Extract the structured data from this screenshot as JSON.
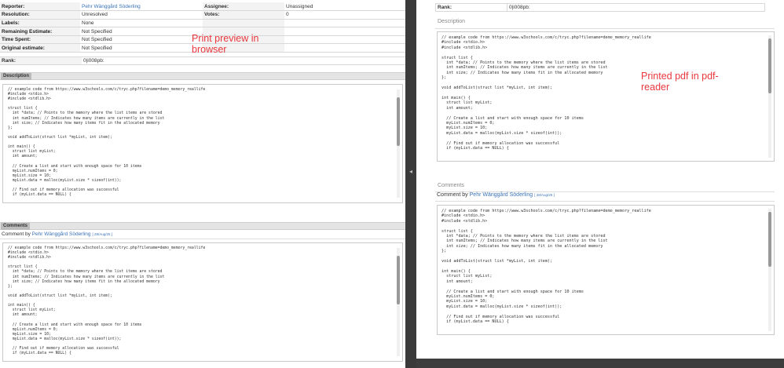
{
  "left": {
    "fields": [
      {
        "label": "Reporter:",
        "value": "Pehr Wänggård Söderling",
        "is_link": true,
        "label2": "Assignee:",
        "value2": "Unassigned"
      },
      {
        "label": "Resolution:",
        "value": "Unresolved",
        "label2": "Votes:",
        "value2": "0"
      },
      {
        "label": "Labels:",
        "value": "None",
        "label2": "",
        "value2": ""
      },
      {
        "label": "Remaining Estimate:",
        "value": "Not Specified",
        "label2": "",
        "value2": ""
      },
      {
        "label": "Time Spent:",
        "value": "Not Specified",
        "label2": "",
        "value2": ""
      },
      {
        "label": "Original estimate:",
        "value": "Not Specified",
        "label2": "",
        "value2": ""
      }
    ],
    "rank_label": "Rank:",
    "rank_value": "0|i008pb:",
    "description_tab": "Description",
    "comments_tab": "Comments",
    "comment_prefix": "Comment by",
    "comment_author": "Pehr Wänggård Söderling",
    "comment_date": "[ 28/Aug/25 ]",
    "annotation": "Print preview in\nbrowser"
  },
  "right": {
    "rank_label": "Rank:",
    "rank_value": "0|i008pb:",
    "description_title": "Description",
    "comments_title": "Comments",
    "comment_prefix": "Comment by",
    "comment_author": "Pehr Wänggård Söderling",
    "comment_date": "[ 28/Aug/25 ]",
    "annotation": "Printed pdf in pdf-\nreader"
  },
  "code": "// example code from https://www.w3schools.com/c/tryc.php?filename=demo_memory_reallife\n#include <stdio.h>\n#include <stdlib.h>\n\nstruct list {\n  int *data; // Points to the memory where the list items are stored\n  int numItems; // Indicates how many items are currently in the list\n  int size; // Indicates how many items fit in the allocated memory\n};\n\nvoid addToList(struct list *myList, int item);\n\nint main() {\n  struct list myList;\n  int amount;\n\n  // Create a list and start with enough space for 10 items\n  myList.numItems = 0;\n  myList.size = 10;\n  myList.data = malloc(myList.size * sizeof(int));\n\n  // Find out if memory allocation was successful\n  if (myList.data == NULL) {",
  "colors": {
    "link": "#3b73b9",
    "annotation": "#e8383d",
    "divider": "#3a3a3a"
  }
}
